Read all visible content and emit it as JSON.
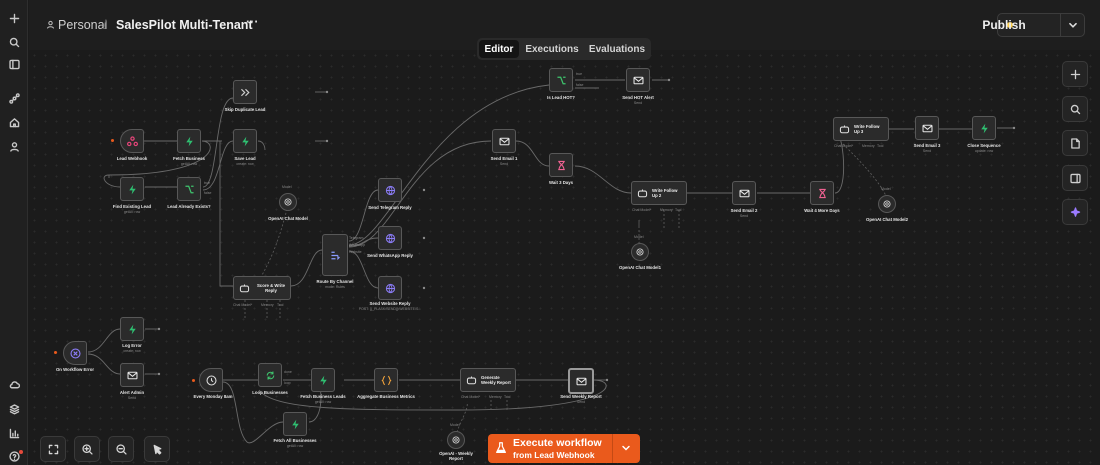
{
  "topbar": {
    "owner": "Personal",
    "workflow_name": "SalesPilot Multi-Tenant",
    "more": "···",
    "publish_label": "Publish"
  },
  "tabs": [
    "Editor",
    "Executions",
    "Evaluations"
  ],
  "nodes": {
    "lead_webhook": {
      "label": "Lead Webhook"
    },
    "fetch_business": {
      "label": "Fetch Business",
      "sub": "getAll: row"
    },
    "skip_duplicate": {
      "label": "Skip Duplicate Lead"
    },
    "save_lead": {
      "label": "Save Lead",
      "sub": "create: row"
    },
    "find_existing": {
      "label": "Find Existing Lead",
      "sub": "getAll: row"
    },
    "lead_exists": {
      "label": "Lead Already Exists?"
    },
    "openai_model": {
      "label": "OpenAI Chat Model"
    },
    "score_write": {
      "label": "Score & Write Reply"
    },
    "route_channel": {
      "label": "Route By Channel",
      "sub": "mode: Rules"
    },
    "send_telegram": {
      "label": "Send Telegram Reply"
    },
    "send_whatsapp": {
      "label": "Send WhatsApp Reply"
    },
    "send_website": {
      "label": "Send Website Reply",
      "sub": "POST: {{_FLASK/SEND}}/WEBSITE/S..."
    },
    "is_lead_hot": {
      "label": "Is Lead HOT?"
    },
    "send_hot_alert": {
      "label": "Send HOT Alert",
      "sub": "Send"
    },
    "send_email1": {
      "label": "Send Email 1",
      "sub": "Send"
    },
    "wait_3days": {
      "label": "Wait 3 Days"
    },
    "write_followup2": {
      "label": "Write Follow Up 2"
    },
    "openai_model1": {
      "label": "OpenAI Chat Model1"
    },
    "send_email2": {
      "label": "Send Email 2",
      "sub": "Send"
    },
    "wait_4more": {
      "label": "Wait 4 More Days"
    },
    "write_followup3": {
      "label": "Write Follow Up 3"
    },
    "openai_model2": {
      "label": "OpenAI Chat Model2"
    },
    "send_email3": {
      "label": "Send Email 3",
      "sub": "Send"
    },
    "close_sequence": {
      "label": "Close Sequence",
      "sub": "update: row"
    },
    "on_workflow_error": {
      "label": "On Workflow Error"
    },
    "log_error": {
      "label": "Log Error",
      "sub": "create: row"
    },
    "alert_admin": {
      "label": "Alert Admin",
      "sub": "Send"
    },
    "every_monday": {
      "label": "Every Monday 8am"
    },
    "loop_businesses": {
      "label": "Loop Businesses"
    },
    "fetch_business_leads": {
      "label": "Fetch Business Leads",
      "sub": "getAll: row"
    },
    "aggregate_metrics": {
      "label": "Aggregate Business Metrics"
    },
    "generate_report": {
      "label": "Generate Weekly Report"
    },
    "send_weekly_report": {
      "label": "Send Weekly Report",
      "sub": "Send"
    },
    "fetch_all_businesses": {
      "label": "Fetch All Businesses",
      "sub": "getAll: row"
    },
    "openai_weekly": {
      "label": "OpenAI - Weekly Report"
    }
  },
  "ports": {
    "true": "true",
    "false": "false",
    "done": "done",
    "loop": "loop",
    "chat_model": "Chat Model*",
    "memory": "Memory",
    "tool": "Tool",
    "model": "Model",
    "telegram": "Telegram",
    "whatsapp": "WhatsApp",
    "website": "Website"
  },
  "execute": {
    "line1": "Execute workflow",
    "line2": "from Lead Webhook"
  },
  "colors": {
    "accent": "#ea5a1c",
    "trigger_bolt": "#2fbf71",
    "email": "#e6e6e6",
    "wait": "#f06292",
    "if_branch": "#3ec46d",
    "globe": "#8b7cf6",
    "ai_sparkle": "#9b7bff",
    "publish_dot": "#f7c948"
  }
}
